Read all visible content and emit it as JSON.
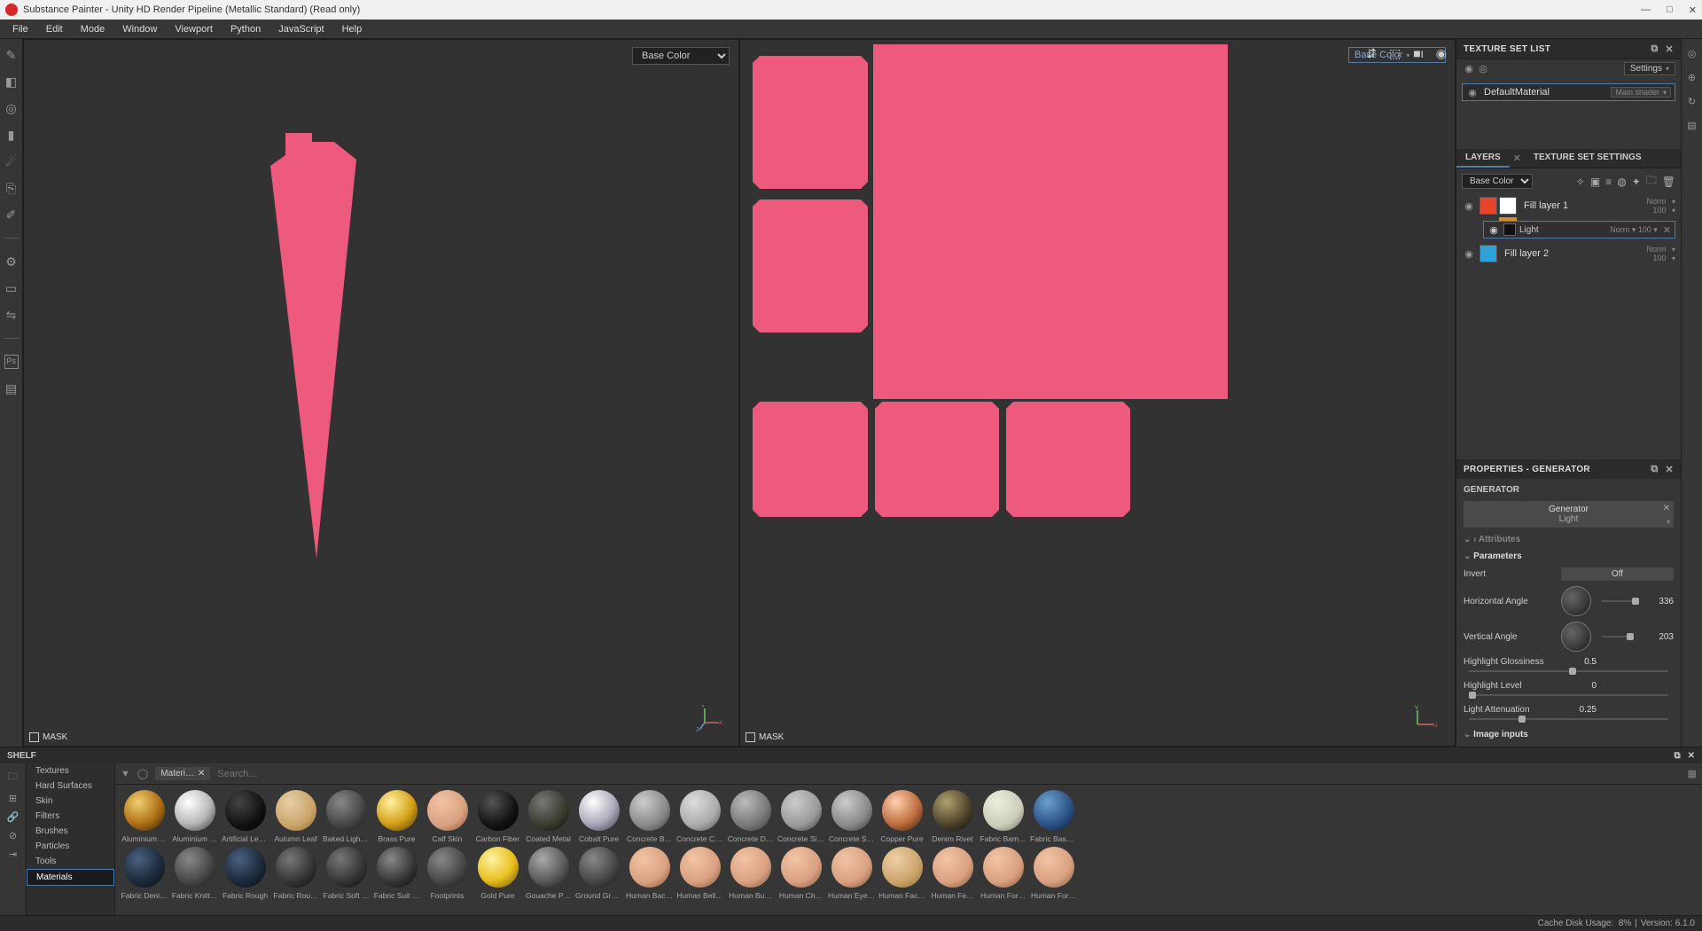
{
  "app": {
    "title": "Substance Painter - Unity HD Render Pipeline (Metallic Standard) (Read only)"
  },
  "menu": [
    "File",
    "Edit",
    "Mode",
    "Window",
    "Viewport",
    "Python",
    "JavaScript",
    "Help"
  ],
  "viewport": {
    "left": {
      "dropdown": "Base Color",
      "mask_label": "MASK"
    },
    "right": {
      "dropdown": "Base Color",
      "mask_label": "MASK"
    }
  },
  "texture_set_list": {
    "title": "TEXTURE SET LIST",
    "settings_label": "Settings",
    "row": {
      "name": "DefaultMaterial",
      "shader": "Main shader"
    }
  },
  "layers": {
    "tab": "LAYERS",
    "other_tab": "TEXTURE SET SETTINGS",
    "channel_dropdown": "Base Color",
    "items": [
      {
        "name": "Fill layer 1",
        "mode": "Norm",
        "opacity": "100",
        "color": "#e8442c",
        "mask_color": "#ffffff",
        "sub": {
          "name": "Light",
          "mode": "Norm",
          "opacity": "100"
        }
      },
      {
        "name": "Fill layer 2",
        "mode": "Norm",
        "opacity": "100",
        "color": "#2fa3d9"
      }
    ]
  },
  "properties": {
    "title": "PROPERTIES - GENERATOR",
    "section": "GENERATOR",
    "generator_label": "Generator",
    "generator_name": "Light",
    "attributes_label": "Attributes",
    "parameters_label": "Parameters",
    "invert_label": "Invert",
    "invert_value": "Off",
    "params": [
      {
        "label": "Horizontal Angle",
        "value": "336",
        "slider": 97
      },
      {
        "label": "Vertical Angle",
        "value": "203",
        "slider": 80
      }
    ],
    "sliders": [
      {
        "label": "Highlight Glossiness",
        "value": "0.5",
        "slider": 50
      },
      {
        "label": "Highlight Level",
        "value": "0",
        "slider": 0
      },
      {
        "label": "Light Attenuation",
        "value": "0.25",
        "slider": 25
      }
    ],
    "image_inputs_label": "Image inputs"
  },
  "shelf": {
    "title": "SHELF",
    "categories": [
      "Textures",
      "Hard Surfaces",
      "Skin",
      "Filters",
      "Brushes",
      "Particles",
      "Tools",
      "Materials"
    ],
    "selected_category": "Materials",
    "chip": "Materi…",
    "search_placeholder": "Search…",
    "row1": [
      {
        "label": "Aluminium …",
        "g": "radial-gradient(circle at 35% 30%,#f0d070 0%,#b07018 55%,#2a1a04 100%)"
      },
      {
        "label": "Aluminium …",
        "g": "radial-gradient(circle at 35% 30%,#ffffff 0%,#b8b8b8 55%,#333 100%)"
      },
      {
        "label": "Artificial Lea…",
        "g": "radial-gradient(circle at 35% 30%,#444 0%,#111 60%,#000 100%)"
      },
      {
        "label": "Autumn Leaf",
        "g": "radial-gradient(circle at 35% 30%,#e6cfa6 0%,#caa46a 60%,#8a6a30 100%)"
      },
      {
        "label": "Baked Light…",
        "g": "radial-gradient(circle at 35% 30%,#888 0%,#444 60%,#111 100%)"
      },
      {
        "label": "Brass Pure",
        "g": "radial-gradient(circle at 35% 30%,#fff2a0 0%,#d4a018 55%,#4a3200 100%)"
      },
      {
        "label": "Calf Skin",
        "g": "radial-gradient(circle at 35% 30%,#f2c4a4 0%,#d8a080 60%,#7a5030 100%)"
      },
      {
        "label": "Carbon Fiber",
        "g": "radial-gradient(circle at 35% 30%,#555 0%,#111 60%,#000 100%)"
      },
      {
        "label": "Coated Metal",
        "g": "radial-gradient(circle at 35% 30%,#777 0%,#3a3a2e 60%,#0a0a06 100%)"
      },
      {
        "label": "Cobalt Pure",
        "g": "radial-gradient(circle at 35% 30%,#fff 0%,#aab 55%,#334 100%)"
      },
      {
        "label": "Concrete B…",
        "g": "radial-gradient(circle at 35% 30%,#ccc 0%,#888 60%,#333 100%)"
      },
      {
        "label": "Concrete Cl…",
        "g": "radial-gradient(circle at 35% 30%,#ddd 0%,#aaa 60%,#444 100%)"
      },
      {
        "label": "Concrete D…",
        "g": "radial-gradient(circle at 35% 30%,#bbb 0%,#777 60%,#333 100%)"
      },
      {
        "label": "Concrete Si…",
        "g": "radial-gradient(circle at 35% 30%,#ccc 0%,#999 60%,#333 100%)"
      },
      {
        "label": "Concrete S…",
        "g": "radial-gradient(circle at 35% 30%,#ccc 0%,#888 60%,#333 100%)"
      },
      {
        "label": "Copper Pure",
        "g": "radial-gradient(circle at 35% 30%,#ffd0b0 0%,#c07040 55%,#3a1a0a 100%)"
      },
      {
        "label": "Denim Rivet",
        "g": "radial-gradient(circle at 35% 30%,#b0a070 0%,#4a4028 60%,#0a0804 100%)"
      },
      {
        "label": "Fabric Bam…",
        "g": "radial-gradient(circle at 35% 30%,#eed 0%,#ccb 60%,#665 100%)"
      },
      {
        "label": "Fabric Base…",
        "g": "radial-gradient(circle at 35% 30%,#6aa0d0 0%,#2a5080 60%,#0a1a30 100%)"
      }
    ],
    "row2": [
      {
        "label": "Fabric Deni…",
        "g": "radial-gradient(circle at 35% 30%,#4a6080 0%,#1a2838 60%,#050a12 100%)"
      },
      {
        "label": "Fabric Knitt…",
        "g": "radial-gradient(circle at 35% 30%,#888 0%,#444 60%,#111 100%)"
      },
      {
        "label": "Fabric Rough",
        "g": "radial-gradient(circle at 35% 30%,#4a6080 0%,#1a2838 60%,#050a12 100%)"
      },
      {
        "label": "Fabric Rou…",
        "g": "radial-gradient(circle at 35% 30%,#777 0%,#333 60%,#0a0a0a 100%)"
      },
      {
        "label": "Fabric Soft …",
        "g": "radial-gradient(circle at 35% 30%,#777 0%,#333 60%,#0a0a0a 100%)"
      },
      {
        "label": "Fabric Suit …",
        "g": "radial-gradient(circle at 35% 30%,#888 0%,#333 60%,#0a0a0a 100%)"
      },
      {
        "label": "Footprints",
        "g": "radial-gradient(circle at 35% 30%,#888 0%,#444 60%,#111 100%)"
      },
      {
        "label": "Gold Pure",
        "g": "radial-gradient(circle at 35% 30%,#fff2a0 0%,#e8c020 55%,#6a4a00 100%)"
      },
      {
        "label": "Gouache P…",
        "g": "radial-gradient(circle at 35% 30%,#aaa 0%,#555 60%,#111 100%)"
      },
      {
        "label": "Ground Gra…",
        "g": "radial-gradient(circle at 35% 30%,#888 0%,#444 60%,#111 100%)"
      },
      {
        "label": "Human Bac…",
        "g": "radial-gradient(circle at 35% 30%,#f2c4a4 0%,#d8a080 60%,#7a5030 100%)"
      },
      {
        "label": "Human Bell…",
        "g": "radial-gradient(circle at 35% 30%,#f2c4a4 0%,#d8a080 60%,#7a5030 100%)"
      },
      {
        "label": "Human Bu…",
        "g": "radial-gradient(circle at 35% 30%,#f2c4a4 0%,#d8a080 60%,#7a5030 100%)"
      },
      {
        "label": "Human Ch…",
        "g": "radial-gradient(circle at 35% 30%,#f2c4a4 0%,#d8a080 60%,#7a5030 100%)"
      },
      {
        "label": "Human Eye…",
        "g": "radial-gradient(circle at 35% 30%,#f2c4a4 0%,#d8a080 60%,#7a5030 100%)"
      },
      {
        "label": "Human Fac…",
        "g": "radial-gradient(circle at 35% 30%,#eecfa6 0%,#caa46a 60%,#8a6a30 100%)"
      },
      {
        "label": "Human Fe…",
        "g": "radial-gradient(circle at 35% 30%,#f2c4a4 0%,#d8a080 60%,#7a5030 100%)"
      },
      {
        "label": "Human For…",
        "g": "radial-gradient(circle at 35% 30%,#f2c4a4 0%,#d8a080 60%,#7a5030 100%)"
      },
      {
        "label": "Human For…",
        "g": "radial-gradient(circle at 35% 30%,#f2c4a4 0%,#d8a080 60%,#7a5030 100%)"
      }
    ]
  },
  "status": {
    "cache_label": "Cache Disk Usage:",
    "cache_value": "8%",
    "version_label": "Version:",
    "version_value": "6.1.0"
  }
}
